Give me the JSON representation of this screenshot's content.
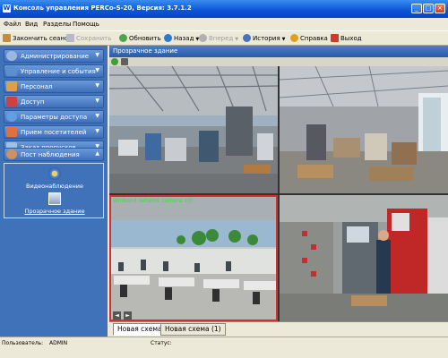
{
  "window": {
    "app_icon": "W",
    "title": "Консоль управления PERCo-S-20, Версия: 3.7.1.2",
    "controls": [
      "_",
      "□",
      "×"
    ]
  },
  "menubar": {
    "items": [
      "Файл",
      "Вид",
      "Разделы",
      "Помощь"
    ]
  },
  "toolbar": {
    "end_session": "Закончить сеанс",
    "save": "Сохранить",
    "refresh": "Обновить",
    "back": "Назад",
    "forward": "Вперед",
    "history": "История",
    "help": "Справка",
    "exit": "Выход"
  },
  "sidebar": {
    "items": [
      {
        "label": "Администрирование",
        "icon": "gear-icon",
        "color": "#9bb8e0"
      },
      {
        "label": "Управление и события",
        "icon": "monitor-icon",
        "color": "#5a8fd0"
      },
      {
        "label": "Персонал",
        "icon": "people-icon",
        "color": "#e0a040"
      },
      {
        "label": "Доступ",
        "icon": "key-icon",
        "color": "#d04040"
      },
      {
        "label": "Параметры доступа",
        "icon": "globe-icon",
        "color": "#60a0e0"
      },
      {
        "label": "Прием посетителей",
        "icon": "visitor-icon",
        "color": "#e07040"
      },
      {
        "label": "Заказ пропусков",
        "icon": "pass-icon",
        "color": "#a0c0e0"
      },
      {
        "label": "Пост наблюдения",
        "icon": "guard-icon",
        "color": "#d09060"
      }
    ],
    "sub_items": [
      {
        "label": "Видеонаблюдение",
        "icon": "camera-icon"
      },
      {
        "label": "Прозрачное здание",
        "icon": "building-icon"
      }
    ]
  },
  "content": {
    "title": "Прозрачное здание",
    "camera_overlay": "Winbond network camera 1/0",
    "tabs": [
      "Новая схема",
      "Новая схема (1)"
    ],
    "tab_nav": [
      "◄",
      "►"
    ]
  },
  "statusbar": {
    "user_label": "Пользователь:",
    "user_value": "ADMIN",
    "status_label": "Статус:"
  },
  "colors": {
    "titlebar": "#0a54d6",
    "sidebar": "#3f72b8",
    "selected_camera_border": "#d23030"
  }
}
